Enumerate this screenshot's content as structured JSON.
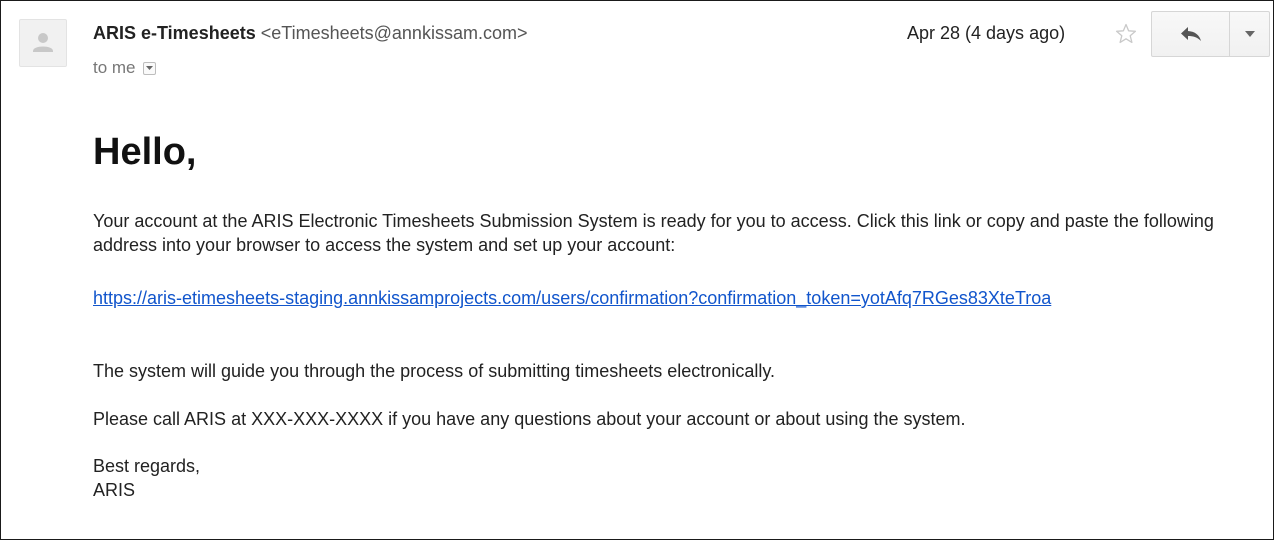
{
  "header": {
    "sender_name": "ARIS e-Timesheets",
    "sender_email": "<eTimesheets@annkissam.com>",
    "to_label": "to me",
    "date": "Apr 28 (4 days ago)"
  },
  "icons": {
    "avatar": "person-icon",
    "to_dropdown": "chevron-down-icon",
    "star": "star-icon",
    "reply": "reply-icon",
    "more": "caret-down-icon"
  },
  "body": {
    "greeting": "Hello,",
    "paragraph1": "Your account at the ARIS Electronic Timesheets Submission System is ready for you to access. Click this link or copy and paste the following address into your browser to access the system and set up your account:",
    "link_text": "https://aris-etimesheets-staging.annkissamprojects.com/users/confirmation?confirmation_token=yotAfq7RGes83XteTroa",
    "paragraph2": "The system will guide you through the process of submitting timesheets electronically.",
    "paragraph3": "Please call ARIS at XXX-XXX-XXXX if you have any questions about your account or about using the system.",
    "closing": "Best regards,",
    "signature": "ARIS"
  },
  "colors": {
    "link": "#1155cc",
    "text": "#222222",
    "muted": "#777777"
  }
}
